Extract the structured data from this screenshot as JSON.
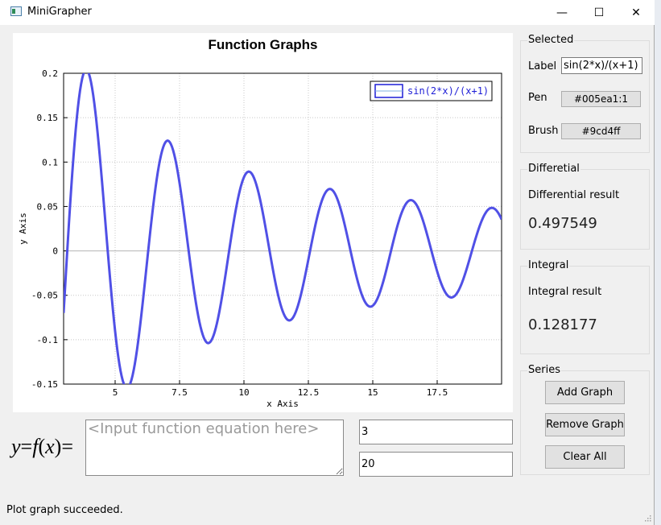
{
  "window": {
    "title": "MiniGrapher",
    "minimize": "—",
    "maximize": "☐",
    "close": "✕"
  },
  "chart_data": {
    "type": "line",
    "title": "Function Graphs",
    "xlabel": "x Axis",
    "ylabel": "y Axis",
    "xlim": [
      3,
      20
    ],
    "ylim": [
      -0.15,
      0.2
    ],
    "xticks": [
      5,
      7.5,
      10,
      12.5,
      15,
      17.5
    ],
    "xtick_labels": [
      "5",
      "7.5",
      "10",
      "12.5",
      "15",
      "17.5"
    ],
    "yticks": [
      -0.15,
      -0.1,
      -0.05,
      0,
      0.05,
      0.1,
      0.15,
      0.2
    ],
    "ytick_labels": [
      "-0.15",
      "-0.1",
      "-0.05",
      "0",
      "0.05",
      "0.1",
      "0.15",
      "0.2"
    ],
    "grid": true,
    "legend_position": "top-right",
    "series": [
      {
        "name": "sin(2*x)/(x+1)",
        "color": "#5050e6",
        "x_range": [
          3,
          20
        ],
        "samples": 400
      }
    ]
  },
  "equation": {
    "prefix": "y=f(x)=",
    "placeholder": "<Input function equation here>",
    "value": ""
  },
  "range": {
    "start": "3",
    "end": "20"
  },
  "selected": {
    "title": "Selected",
    "label_caption": "Label",
    "label_value": "sin(2*x)/(x+1)",
    "pen_caption": "Pen",
    "pen_value": "#005ea1:1",
    "brush_caption": "Brush",
    "brush_value": "#9cd4ff"
  },
  "differential": {
    "title": "Differetial",
    "caption": "Differential result",
    "value": "0.497549"
  },
  "integral": {
    "title": "Integral",
    "caption": "Integral result",
    "value": "0.128177"
  },
  "series_group": {
    "title": "Series",
    "add": "Add Graph",
    "remove": "Remove Graph",
    "clear": "Clear All"
  },
  "status": {
    "text": "Plot graph succeeded."
  }
}
